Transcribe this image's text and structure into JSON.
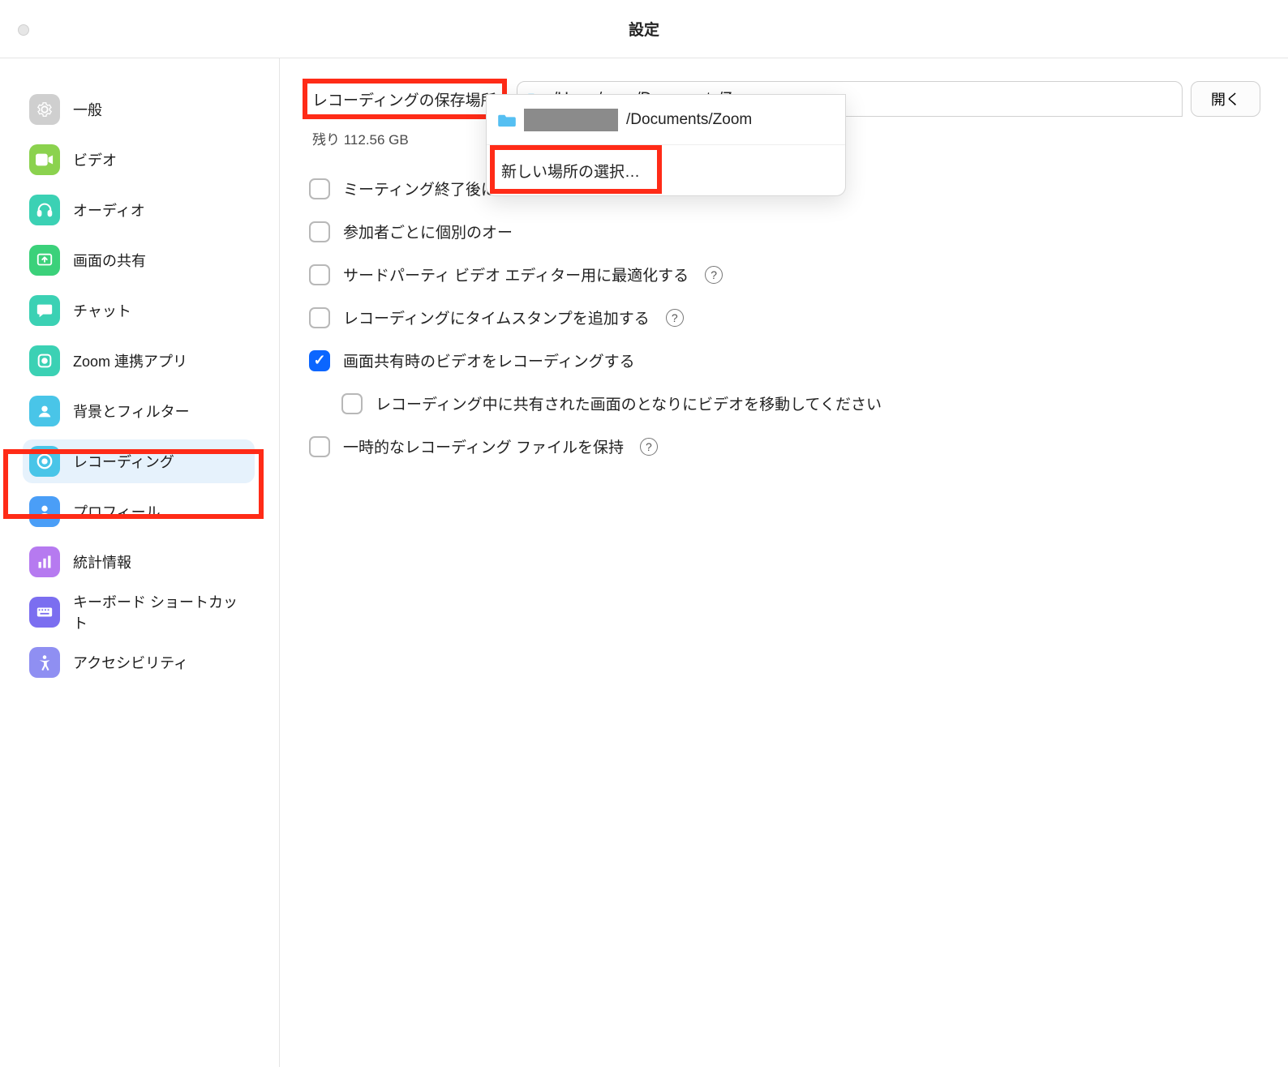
{
  "titlebar": {
    "title": "設定"
  },
  "sidebar": {
    "items": [
      {
        "label": "一般"
      },
      {
        "label": "ビデオ"
      },
      {
        "label": "オーディオ"
      },
      {
        "label": "画面の共有"
      },
      {
        "label": "チャット"
      },
      {
        "label": "Zoom 連携アプリ"
      },
      {
        "label": "背景とフィルター"
      },
      {
        "label": "レコーディング"
      },
      {
        "label": "プロフィール"
      },
      {
        "label": "統計情報"
      },
      {
        "label": "キーボード ショートカット"
      },
      {
        "label": "アクセシビリティ"
      }
    ]
  },
  "main": {
    "location_label": "レコーディングの保存場所:",
    "current_path": "/Users/anna/Documents/Zoom",
    "open_button": "開く",
    "remaining": "残り 112.56 GB",
    "dropdown": {
      "alt_path_suffix": "/Documents/Zoom",
      "choose_new": "新しい場所の選択…"
    },
    "options": {
      "o1": "ミーティング終了後に、",
      "o2": "参加者ごとに個別のオー",
      "o3": "サードパーティ ビデオ エディター用に最適化する",
      "o4": "レコーディングにタイムスタンプを追加する",
      "o5": "画面共有時のビデオをレコーディングする",
      "o5a": "レコーディング中に共有された画面のとなりにビデオを移動してください",
      "o6": "一時的なレコーディング ファイルを保持"
    }
  }
}
